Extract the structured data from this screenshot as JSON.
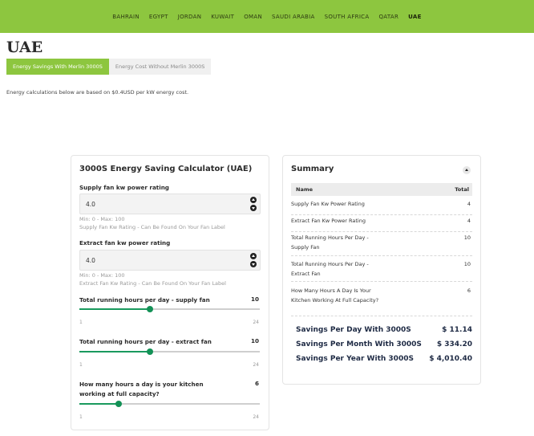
{
  "nav": {
    "items": [
      "BAHRAIN",
      "EGYPT",
      "JORDAN",
      "KUWAIT",
      "OMAN",
      "SAUDI ARABIA",
      "SOUTH AFRICA",
      "QATAR",
      "UAE"
    ],
    "active": "UAE"
  },
  "page_title": "UAE",
  "tabs": [
    "Energy Savings With Merlin 3000S",
    "Energy Cost Without Merlin 3000S"
  ],
  "note": "Energy calculations below are based on $0.4USD per kW energy cost.",
  "calculator": {
    "title": "3000S Energy Saving Calculator (UAE)",
    "supply_fan": {
      "label": "Supply fan kw power rating",
      "value": "4.0",
      "range_hint": "Min: 0 - Max: 100",
      "help": "Supply Fan Kw Rating - Can Be Found On Your Fan Label"
    },
    "extract_fan": {
      "label": "Extract fan kw power rating",
      "value": "4.0",
      "range_hint": "Min: 0 - Max: 100",
      "help": "Extract Fan Kw Rating - Can Be Found On Your Fan Label"
    },
    "sliders": [
      {
        "label": "Total running hours per day - supply fan",
        "value": 10,
        "value_label": "10",
        "min": 1,
        "max": 24,
        "min_label": "1",
        "max_label": "24"
      },
      {
        "label": "Total running hours per day - extract fan",
        "value": 10,
        "value_label": "10",
        "min": 1,
        "max": 24,
        "min_label": "1",
        "max_label": "24"
      },
      {
        "label": "How many hours a day is your kitchen working at full capacity?",
        "value": 6,
        "value_label": "6",
        "min": 1,
        "max": 24,
        "min_label": "1",
        "max_label": "24"
      }
    ]
  },
  "summary": {
    "title": "Summary",
    "head_name": "Name",
    "head_total": "Total",
    "rows": [
      {
        "name": "Supply Fan Kw Power Rating",
        "value": "4"
      },
      {
        "name": "Extract Fan Kw Power Rating",
        "value": "4"
      },
      {
        "name": "Total Running Hours Per Day - Supply Fan",
        "value": "10"
      },
      {
        "name": "Total Running Hours Per Day - Extract Fan",
        "value": "10"
      },
      {
        "name": "How Many Hours A Day Is Your Kitchen Working At Full Capacity?",
        "value": "6"
      }
    ],
    "savings": [
      {
        "name": "Savings Per Day With 3000S",
        "value": "$ 11.14"
      },
      {
        "name": "Savings Per Month With 3000S",
        "value": "$ 334.20"
      },
      {
        "name": "Savings Per Year With 3000S",
        "value": "$ 4,010.40"
      }
    ]
  },
  "colors": {
    "accent": "#8dc63f",
    "slider": "#139156",
    "savings_text": "#1e2a44"
  }
}
